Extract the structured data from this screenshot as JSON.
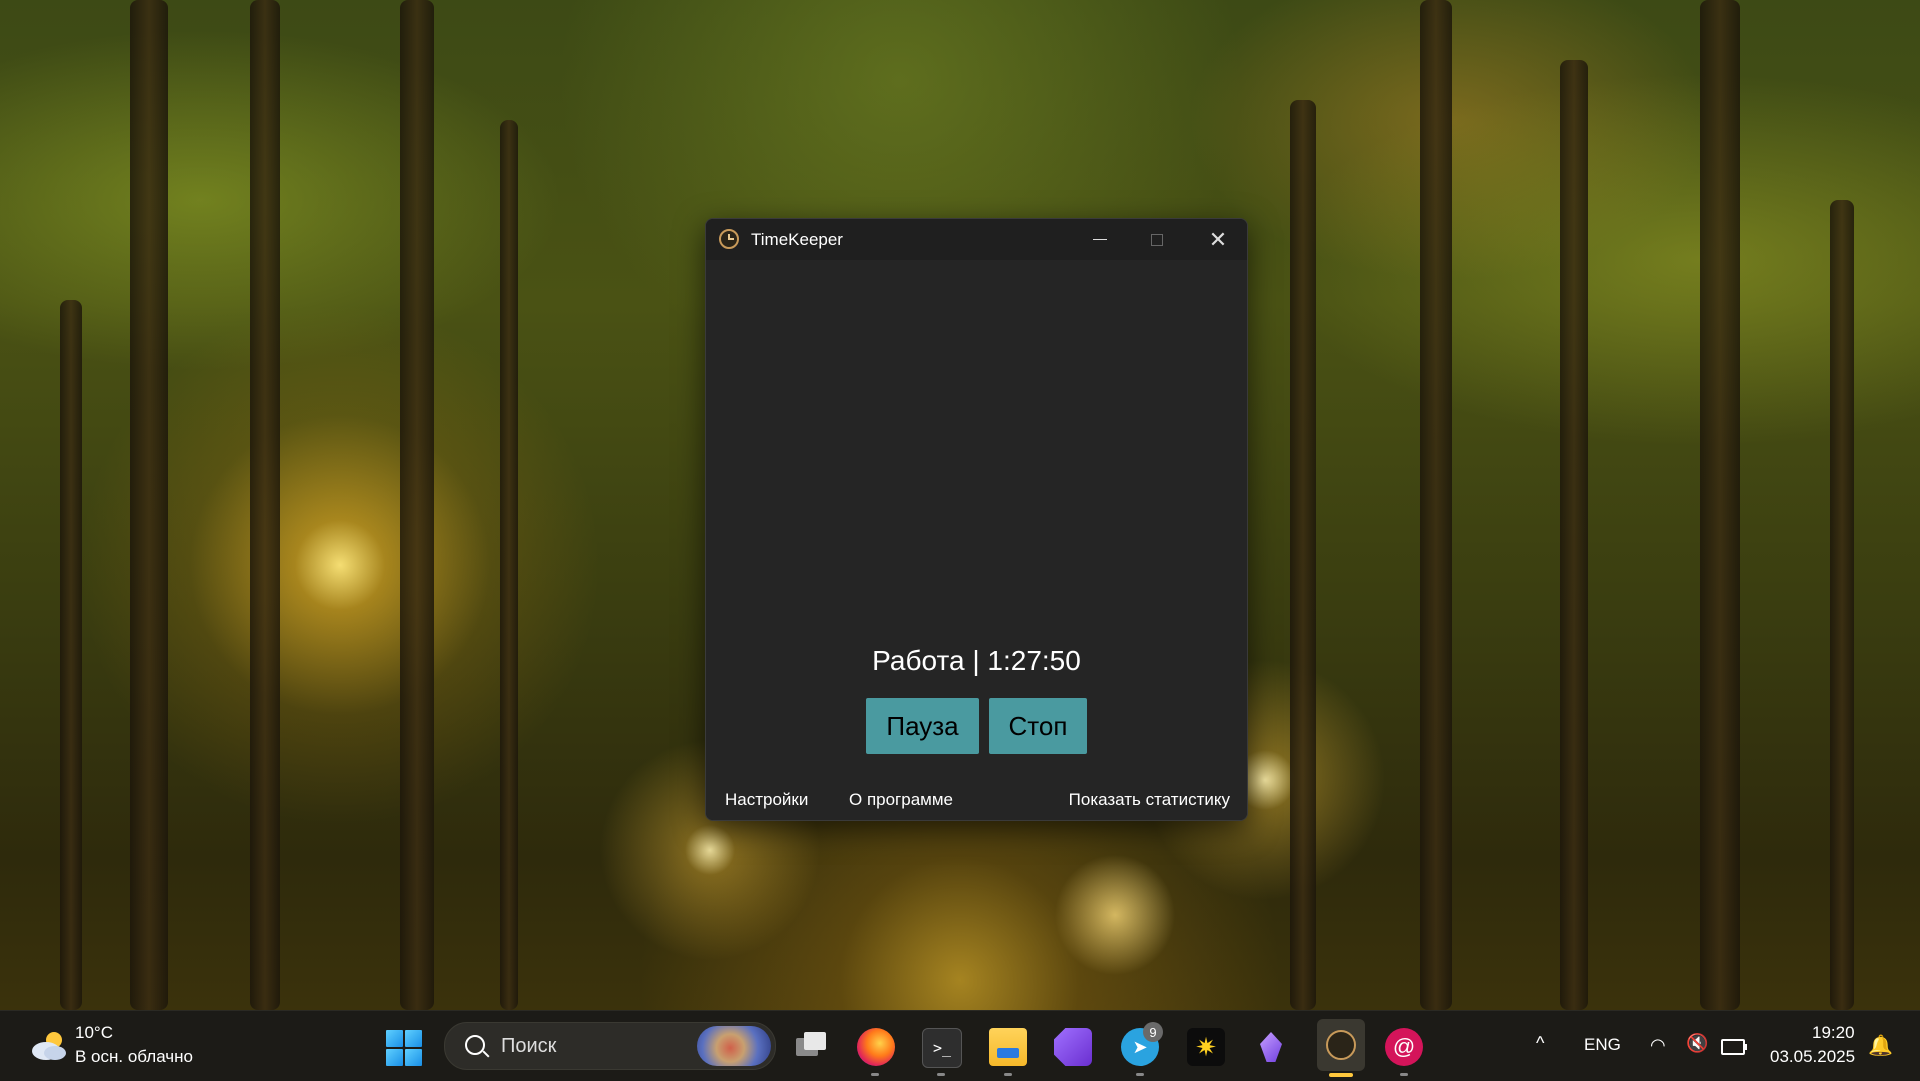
{
  "window": {
    "title": "TimeKeeper",
    "status": "Работа | 1:27:50",
    "buttons": {
      "pause": "Пауза",
      "stop": "Стоп"
    },
    "links": {
      "settings": "Настройки",
      "about": "О программе",
      "stats": "Показать статистику"
    },
    "controls": {
      "close": "✕"
    }
  },
  "taskbar": {
    "weather": {
      "temp": "10°C",
      "desc": "В осн. облачно"
    },
    "search": {
      "placeholder": "Поиск"
    },
    "terminal_glyph": ">_",
    "telegram_badge": "9",
    "telegram_glyph": "➤",
    "sun_glyph": "✷",
    "debian_glyph": "@",
    "tray": {
      "chevron": "^",
      "lang": "ENG",
      "wifi": "◠",
      "volume": "🔇",
      "notifications": "🔔"
    },
    "clock": {
      "time": "19:20",
      "date": "03.05.2025"
    }
  },
  "colors": {
    "accent": "#4a9aa0",
    "window_bg": "#252525",
    "taskbar_bg": "#1c1b17"
  },
  "icons": [
    "timekeeper-icon",
    "windows-start-icon",
    "search-icon",
    "task-view-icon",
    "firefox-icon",
    "terminal-icon",
    "file-explorer-icon",
    "visual-studio-icon",
    "telegram-icon",
    "sun-app-icon",
    "crystal-app-icon",
    "debian-icon",
    "wifi-icon",
    "volume-muted-icon",
    "battery-icon",
    "notification-icon"
  ]
}
